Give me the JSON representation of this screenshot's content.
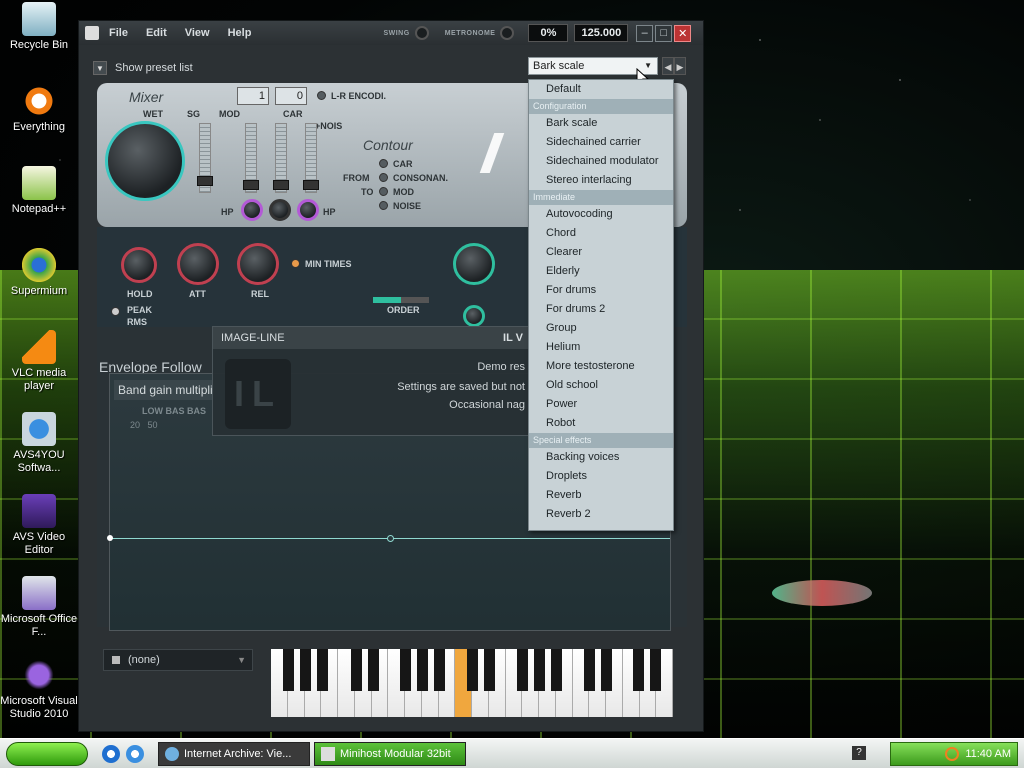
{
  "desktop": {
    "icons": [
      {
        "label": "Recycle Bin"
      },
      {
        "label": "Everything"
      },
      {
        "label": "Notepad++"
      },
      {
        "label": "Supermium"
      },
      {
        "label": "VLC media player"
      },
      {
        "label": "AVS4YOU Softwa..."
      },
      {
        "label": "AVS Video Editor"
      },
      {
        "label": "Microsoft Office F..."
      },
      {
        "label": "Microsoft Visual Studio 2010"
      }
    ]
  },
  "window": {
    "menu": [
      "File",
      "Edit",
      "View",
      "Help"
    ],
    "swing_label": "SWING",
    "metronome_label": "METRONOME",
    "cpu": "0%",
    "tempo": "125.000"
  },
  "preset": {
    "toggle_label": "Show preset list",
    "selected": "Bark scale"
  },
  "mixer": {
    "title": "Mixer",
    "wet": "WET",
    "sg": "SG",
    "mod": "MOD",
    "car": "CAR",
    "noise": "+NOIS",
    "hp_left": "HP",
    "hp_right": "HP",
    "num1": "1",
    "num2": "0",
    "lr": "L-R ENCODI.",
    "contour_title": "Contour",
    "contour_items": [
      "CAR",
      "CONSONAN.",
      "MOD",
      "NOISE"
    ],
    "from": "FROM",
    "to": "TO"
  },
  "controls": {
    "hold": "HOLD",
    "att": "ATT",
    "rel": "REL",
    "min_times": "MIN TIMES",
    "peak": "PEAK",
    "rms": "RMS",
    "order": "ORDER"
  },
  "envelope": {
    "title": "Envelope Follow",
    "band_gain": "Band gain multipli",
    "bands": "LOW BAS BAS",
    "freqs": "20   50"
  },
  "il_dialog": {
    "header": "IMAGE-LINE",
    "header_right": "IL V",
    "logo": "IL",
    "line1": "Demo res",
    "line2": "Settings are saved but not",
    "line3": "Occasional nag"
  },
  "footer": {
    "channel": "(none)"
  },
  "dropdown": {
    "default": "Default",
    "categories": [
      {
        "name": "Configuration",
        "items": [
          "Bark scale",
          "Sidechained carrier",
          "Sidechained modulator",
          "Stereo interlacing"
        ]
      },
      {
        "name": "Immediate",
        "items": [
          "Autovocoding",
          "Chord",
          "Clearer",
          "Elderly",
          "For drums",
          "For drums 2",
          "Group",
          "Helium",
          "More testosterone",
          "Old school",
          "Power",
          "Robot"
        ]
      },
      {
        "name": "Special effects",
        "items": [
          "Backing voices",
          "Droplets",
          "Reverb",
          "Reverb 2"
        ]
      }
    ]
  },
  "taskbar": {
    "task1": "Internet Archive: Vie...",
    "task2": "Minihost Modular 32bit",
    "clock": "11:40 AM"
  },
  "colors": {
    "accent": "#f0a73e",
    "teal": "#2fbf9f",
    "close": "#b33333"
  }
}
